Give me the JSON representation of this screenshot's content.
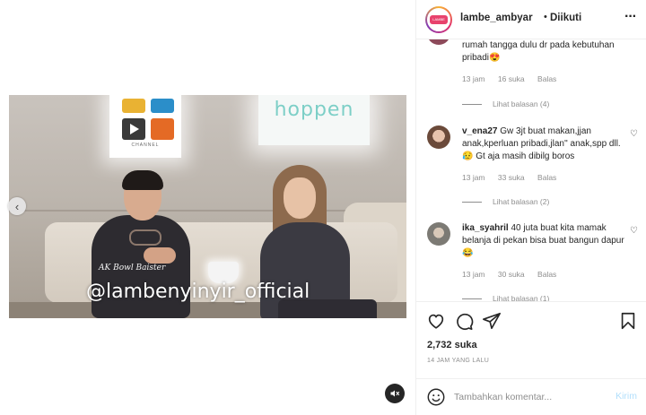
{
  "post": {
    "watermark": "@lambenyinyir_official",
    "signature": "AK Bowl Baister",
    "logo_caption": "CHANNEL",
    "sign_text": "hoppen"
  },
  "header": {
    "username": "lambe_ambyar",
    "separator": "•",
    "follow_status": "Diikuti",
    "more_icon": "more-horizontal-icon"
  },
  "comments": [
    {
      "username": "",
      "text": "rumah tangga dulu dr pada kebutuhan pribadi😍",
      "time": "13 jam",
      "likes": "16 suka",
      "reply": "Balas",
      "view_replies": "Lihat balasan (4)"
    },
    {
      "username": "v_ena27",
      "text": "Gw 3jt buat makan,jjan anak,kperluan pribadi,jlan'' anak,spp dll.😥 Gt aja masih dibilg boros",
      "time": "13 jam",
      "likes": "33 suka",
      "reply": "Balas",
      "view_replies": "Lihat balasan (2)"
    },
    {
      "username": "ika_syahril",
      "text": "40 juta buat kita mamak belanja di pekan bisa buat bangun dapur 😂",
      "time": "13 jam",
      "likes": "30 suka",
      "reply": "Balas",
      "view_replies": "Lihat balasan (1)"
    }
  ],
  "actions": {
    "likes": "2,732 suka",
    "timestamp": "14 JAM YANG LALU"
  },
  "add_comment": {
    "placeholder": "Tambahkan komentar...",
    "post_label": "Kirim"
  }
}
